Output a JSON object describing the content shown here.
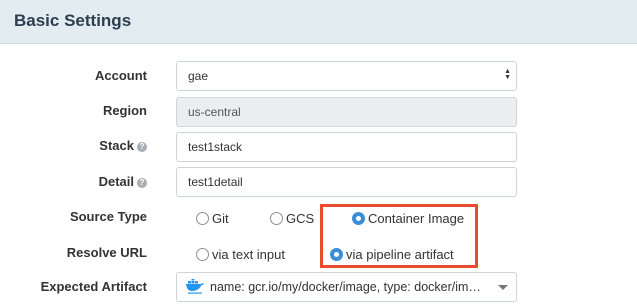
{
  "section": {
    "title": "Basic Settings"
  },
  "fields": {
    "account": {
      "label": "Account",
      "value": "gae"
    },
    "region": {
      "label": "Region",
      "value": "us-central"
    },
    "stack": {
      "label": "Stack",
      "value": "test1stack"
    },
    "detail": {
      "label": "Detail",
      "value": "test1detail"
    }
  },
  "source_type": {
    "label": "Source Type",
    "options": [
      "Git",
      "GCS",
      "Container Image"
    ],
    "selected": "Container Image"
  },
  "resolve_url": {
    "label": "Resolve URL",
    "options": [
      "via text input",
      "via pipeline artifact"
    ],
    "selected": "via pipeline artifact"
  },
  "expected_artifact": {
    "label": "Expected Artifact",
    "value": "name: gcr.io/my/docker/image, type: docker/im…",
    "icon": "docker-icon"
  },
  "colors": {
    "header_bg": "#e3ecf1",
    "accent": "#3a8ed8",
    "highlight": "#e94b2c"
  }
}
